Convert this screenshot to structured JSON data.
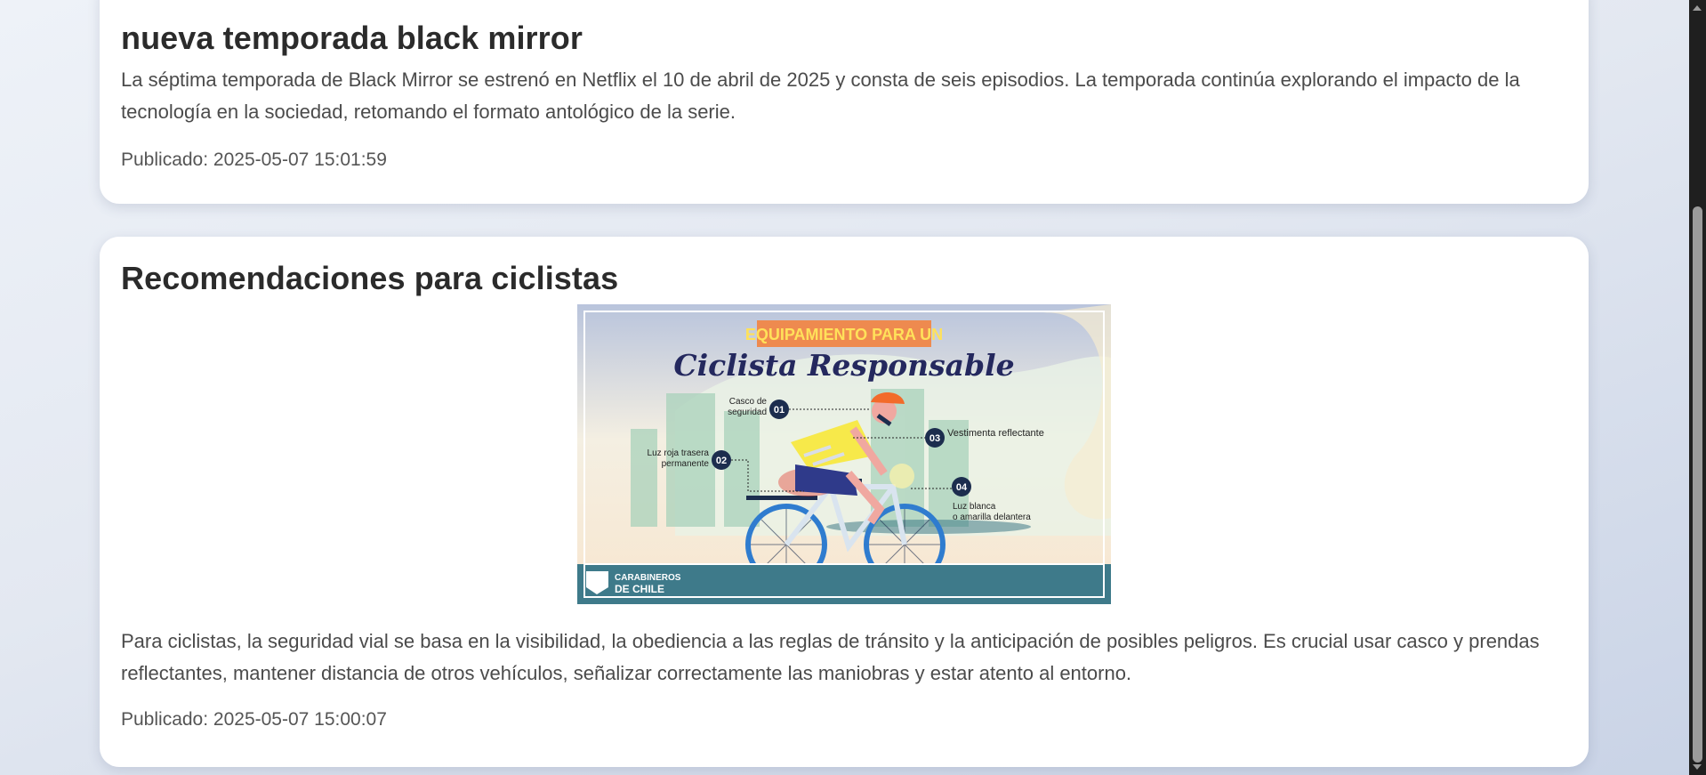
{
  "posts": [
    {
      "title": "nueva temporada black mirror",
      "body": "La séptima temporada de Black Mirror se estrenó en Netflix el 10 de abril de 2025 y consta de seis episodios. La temporada continúa explorando el impacto de la tecnología en la sociedad, retomando el formato antológico de la serie.",
      "published": "Publicado: 2025-05-07 15:01:59"
    },
    {
      "title": "Recomendaciones para ciclistas",
      "image": {
        "banner": "EQUIPAMIENTO PARA UN",
        "headline": "Ciclista Responsable",
        "items": [
          {
            "num": "01",
            "label_l1": "Casco de",
            "label_l2": "seguridad"
          },
          {
            "num": "02",
            "label_l1": "Luz roja trasera",
            "label_l2": "permanente"
          },
          {
            "num": "03",
            "label_l1": "Vestimenta reflectante",
            "label_l2": ""
          },
          {
            "num": "04",
            "label_l1": "Luz blanca",
            "label_l2": "o amarilla delantera"
          }
        ],
        "logo_l1": "CARABINEROS",
        "logo_l2": "DE CHILE"
      },
      "body": "Para ciclistas, la seguridad vial se basa en la visibilidad, la obediencia a las reglas de tránsito y la anticipación de posibles peligros. Es crucial usar casco y prendas reflectantes, mantener distancia de otros vehículos, señalizar correctamente las maniobras y estar atento al entorno.",
      "published": "Publicado: 2025-05-07 15:00:07"
    }
  ],
  "colors": {
    "card_bg": "#ffffff",
    "banner_bg": "#ee8a4f",
    "banner_text": "#ffe15a",
    "headline": "#24285e",
    "footer_band": "#3e7a8a"
  }
}
